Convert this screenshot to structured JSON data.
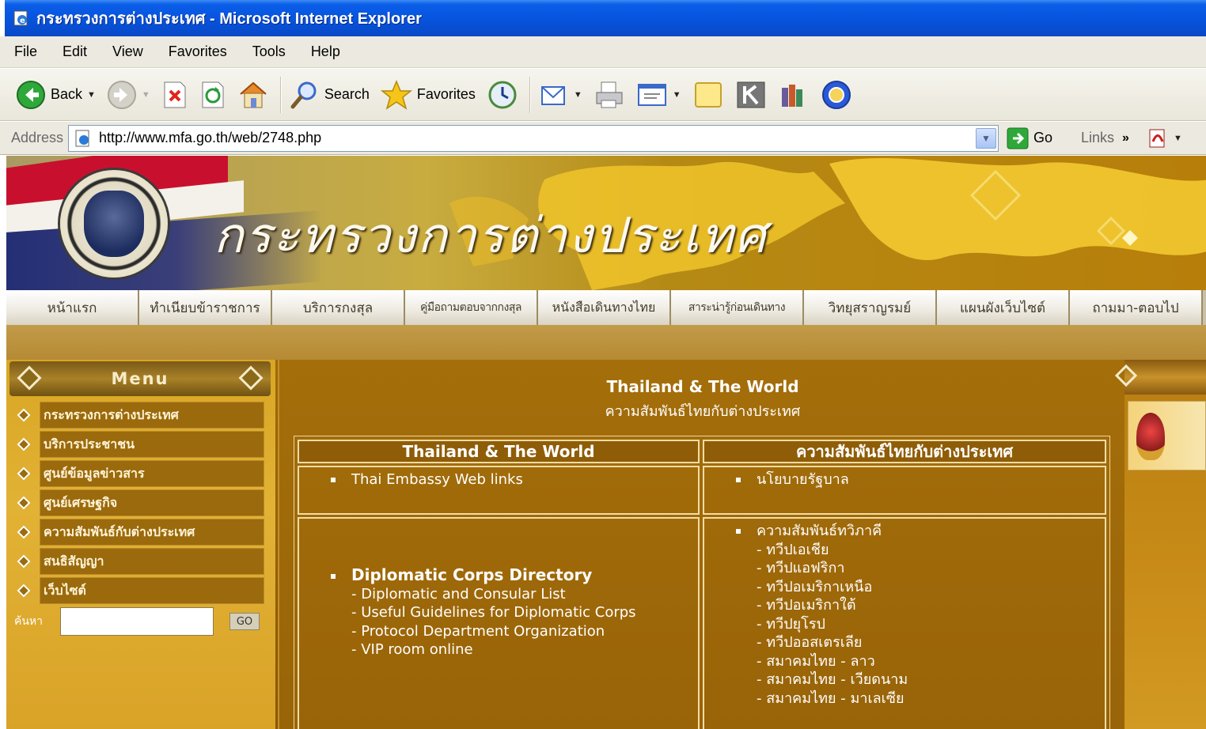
{
  "window": {
    "title": "กระทรวงการต่างประเทศ - Microsoft Internet Explorer"
  },
  "menubar": {
    "items": [
      "File",
      "Edit",
      "View",
      "Favorites",
      "Tools",
      "Help"
    ]
  },
  "toolbar": {
    "back_label": "Back",
    "search_label": "Search",
    "favorites_label": "Favorites"
  },
  "addressbar": {
    "label": "Address",
    "url": "http://www.mfa.go.th/web/2748.php",
    "go_label": "Go",
    "links_label": "Links"
  },
  "site": {
    "title": "กระทรวงการต่างประเทศ",
    "nav": [
      "หน้าแรก",
      "ทำเนียบข้าราชการ",
      "บริการกงสุล",
      "คู่มือถามตอบจากกงสุล",
      "หนังสือเดินทางไทย",
      "สาระน่ารู้ก่อนเดินทาง",
      "วิทยุสราญรมย์",
      "แผนผังเว็บไซต์",
      "ถามมา-ตอบไป"
    ]
  },
  "sidebar": {
    "menu_title": "Menu",
    "items": [
      "กระทรวงการต่างประเทศ",
      "บริการประชาชน",
      "ศูนย์ข้อมูลข่าวสาร",
      "ศูนย์เศรษฐกิจ",
      "ความสัมพันธ์กับต่างประเทศ",
      "สนธิสัญญา",
      "เว็บไซต์"
    ],
    "search_label": "ค้นหา",
    "go_label": "GO"
  },
  "main": {
    "heading": "Thailand & The World",
    "subheading": "ความสัมพันธ์ไทยกับต่างประเทศ",
    "col1_header": "Thailand & The World",
    "col2_header": "ความสัมพันธ์ไทยกับต่างประเทศ",
    "col1_row1": "Thai Embassy Web links",
    "col2_row1": "นโยบายรัฐบาล",
    "col1_row2_title": "Diplomatic Corps Directory",
    "col1_row2_items": [
      "- Diplomatic and Consular List",
      "- Useful Guidelines for Diplomatic Corps",
      "- Protocol Department Organization",
      "- VIP room online"
    ],
    "col2_row2_title": "ความสัมพันธ์ทวิภาคี",
    "col2_row2_items": [
      "- ทวีปเอเชีย",
      "- ทวีปแอฟริกา",
      "- ทวีปอเมริกาเหนือ",
      "- ทวีปอเมริกาใต้",
      "- ทวีปยุโรป",
      "- ทวีปออสเตรเลีย",
      "- สมาคมไทย - ลาว",
      "- สมาคมไทย - เวียดนาม",
      "- สมาคมไทย - มาเลเซีย"
    ]
  },
  "colors": {
    "titlebar": "#0753dd",
    "page_gold": "#a46e0a",
    "cell_border": "#f2dca6"
  }
}
